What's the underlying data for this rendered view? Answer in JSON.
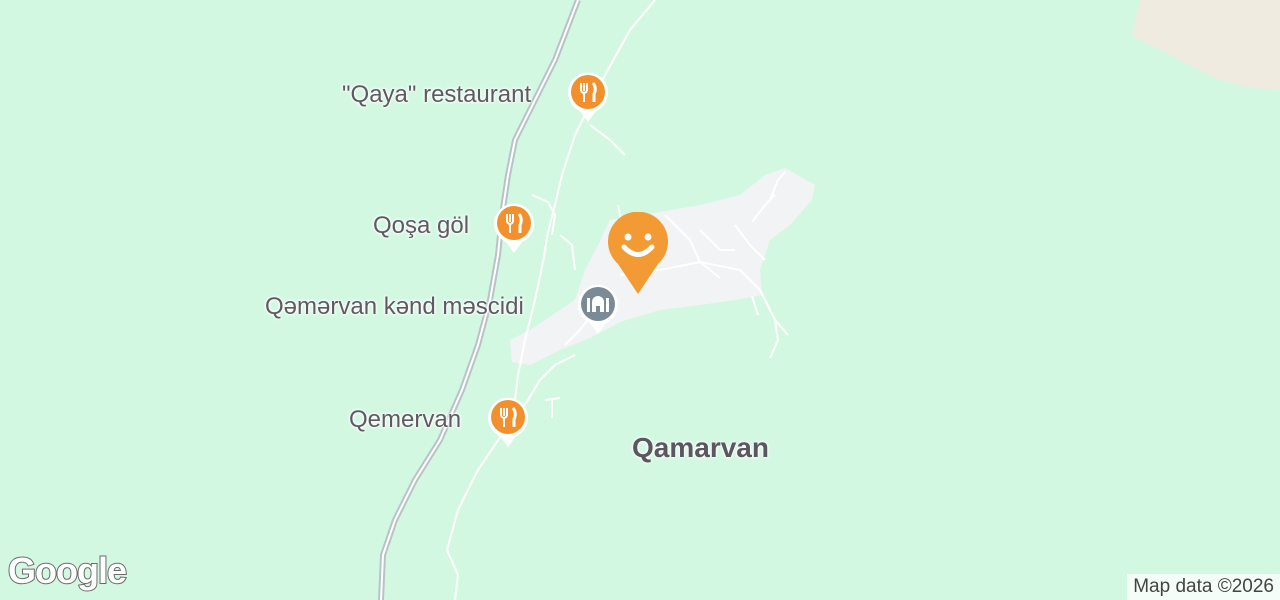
{
  "map": {
    "colors": {
      "land": "#d3f8e2",
      "village": "#f1f3f4",
      "road": "#ffffff",
      "highway": "#b9c2c7",
      "terrain": "#efebe1",
      "poi_orange": "#f2902d",
      "poi_gray": "#7b8a97"
    }
  },
  "pois": [
    {
      "name": "\"Qaya\" restaurant",
      "icon": "restaurant-icon"
    },
    {
      "name": "Qoşa göl",
      "icon": "restaurant-icon"
    },
    {
      "name": "Qəmərvan kənd məscidi",
      "icon": "mosque-icon"
    },
    {
      "name": "Qemervan",
      "icon": "restaurant-icon"
    }
  ],
  "place": {
    "name": "Qamarvan"
  },
  "marker": {
    "icon": "smile-marker-icon"
  },
  "logo": {
    "text": "Google"
  },
  "attribution": {
    "text": "Map data ©2026"
  }
}
